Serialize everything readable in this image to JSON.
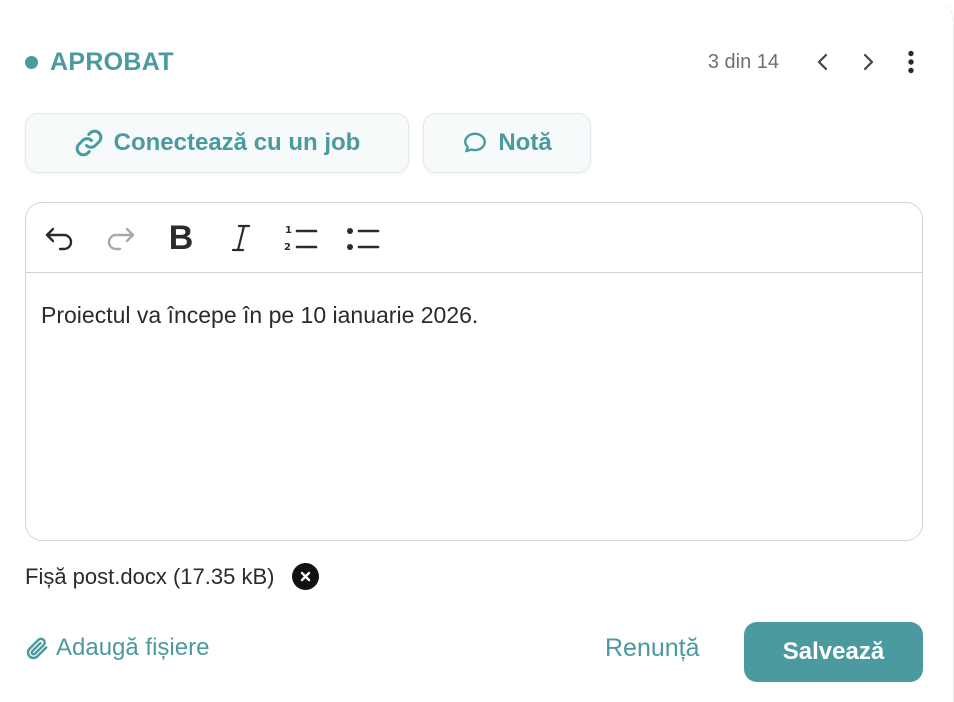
{
  "header": {
    "status_label": "APROBAT",
    "page_counter": "3 din 14",
    "icons": {
      "prev": "chevron-left-icon",
      "next": "chevron-right-icon",
      "more": "more-vertical-icon"
    }
  },
  "actions": {
    "connect_job_label": "Conectează cu un job",
    "note_label": "Notă"
  },
  "editor": {
    "toolbar": [
      "undo-icon",
      "redo-icon",
      "bold-icon",
      "italic-icon",
      "ordered-list-icon",
      "bullet-list-icon"
    ],
    "bold_glyph": "B",
    "content": "Proiectul va începe în pe 10 ianuarie 2026."
  },
  "attachment": {
    "file_name": "Fișă post.docx (17.35 kB)"
  },
  "footer": {
    "add_files_label": "Adaugă fișiere",
    "cancel_label": "Renunță",
    "save_label": "Salvează"
  },
  "colors": {
    "accent": "#4a9aa0",
    "chip_bg": "#f6fafb",
    "text": "#2b2b2b",
    "muted": "#6f6f6f"
  }
}
